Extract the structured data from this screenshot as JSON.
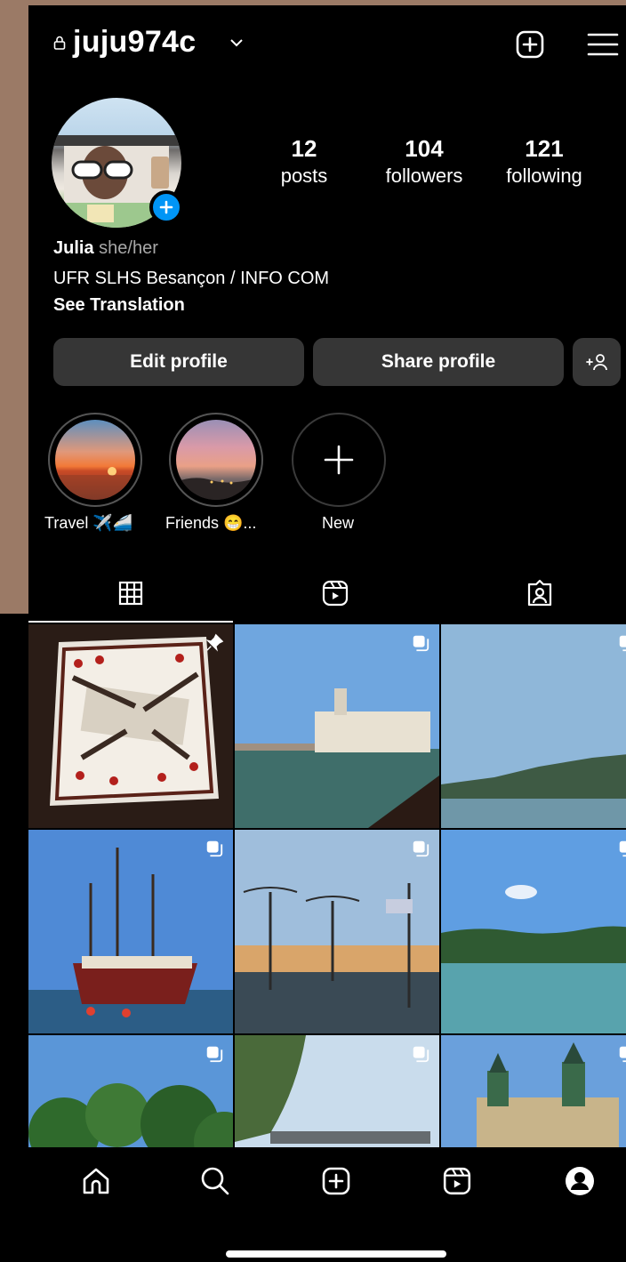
{
  "header": {
    "username": "juju974c"
  },
  "profile": {
    "stats": [
      {
        "value": "12",
        "label": "posts"
      },
      {
        "value": "104",
        "label": "followers"
      },
      {
        "value": "121",
        "label": "following"
      }
    ],
    "name": "Julia",
    "pronouns": "she/her",
    "bio": "UFR SLHS Besançon / INFO COM",
    "translate": "See Translation"
  },
  "buttons": {
    "edit": "Edit profile",
    "share": "Share profile"
  },
  "highlights": [
    {
      "label": "Travel ✈️🚄"
    },
    {
      "label": "Friends 😁..."
    },
    {
      "label": "New"
    }
  ],
  "tabs": [
    "grid-icon",
    "reels-icon",
    "tagged-icon"
  ],
  "colors": {
    "accent": "#0095f6",
    "button": "#363636",
    "frame": "#9b7a66"
  }
}
